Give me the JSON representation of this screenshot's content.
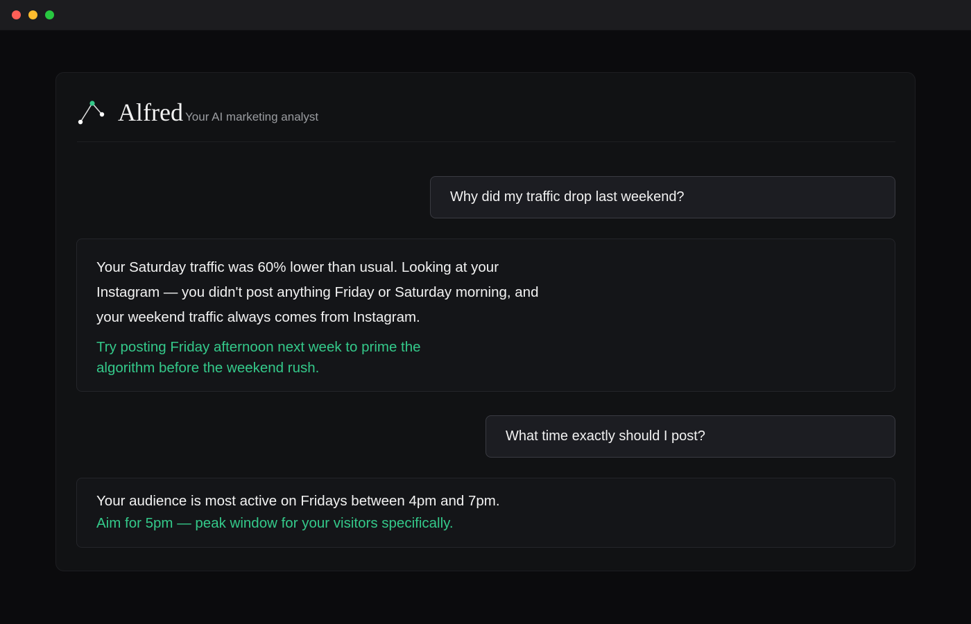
{
  "window": {
    "controls": [
      "close",
      "minimize",
      "maximize"
    ]
  },
  "header": {
    "logo_icon": "line-chart-icon",
    "brand": "Alfred",
    "tagline": "Your AI marketing analyst"
  },
  "conversation": {
    "messages": [
      {
        "role": "user",
        "text": "Why did my traffic drop last weekend?"
      },
      {
        "role": "assistant",
        "text": "Your Saturday traffic was 60% lower than usual. Looking at your Instagram — you didn't post anything Friday or Saturday morning, and your weekend traffic always comes from Instagram.",
        "highlight": "Try posting Friday afternoon next week to prime the algorithm before the weekend rush."
      },
      {
        "role": "user",
        "text": "What time exactly should I post?"
      },
      {
        "role": "assistant",
        "text": "Your audience is most active on Fridays between 4pm and 7pm.",
        "highlight": "Aim for 5pm — peak window for your visitors specifically."
      }
    ]
  },
  "colors": {
    "accent": "#34c98a",
    "background": "#0b0b0d",
    "panel": "#111214",
    "user_bubble": "#1c1d22"
  }
}
